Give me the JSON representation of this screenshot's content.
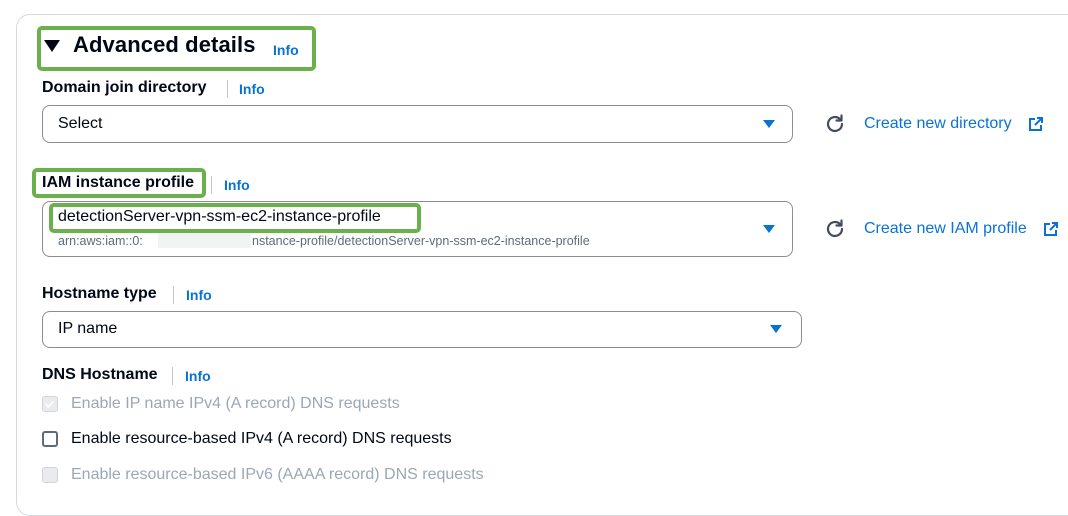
{
  "header": {
    "title": "Advanced details",
    "info": "Info"
  },
  "domain_join": {
    "label": "Domain join directory",
    "info": "Info",
    "value": "Select",
    "create_link": "Create new directory"
  },
  "iam_profile": {
    "label": "IAM instance profile",
    "info": "Info",
    "value": "detectionServer-vpn-ssm-ec2-instance-profile",
    "arn_prefix": "arn:aws:iam::0:",
    "arn_suffix": "nstance-profile/detectionServer-vpn-ssm-ec2-instance-profile",
    "create_link": "Create new IAM profile"
  },
  "hostname_type": {
    "label": "Hostname type",
    "info": "Info",
    "value": "IP name"
  },
  "dns_hostname": {
    "label": "DNS Hostname",
    "info": "Info",
    "options": [
      {
        "label": "Enable IP name IPv4 (A record) DNS requests",
        "checked": true,
        "disabled": true
      },
      {
        "label": "Enable resource-based IPv4 (A record) DNS requests",
        "checked": false,
        "disabled": false
      },
      {
        "label": "Enable resource-based IPv6 (AAAA record) DNS requests",
        "checked": false,
        "disabled": true
      }
    ]
  },
  "colors": {
    "accent": "#0972d3",
    "highlight": "#6ab04c",
    "text": "#000716",
    "disabled": "#9ba7b6"
  },
  "icons": [
    "caret-down-icon",
    "refresh-icon",
    "external-link-icon",
    "checkbox-icon"
  ]
}
